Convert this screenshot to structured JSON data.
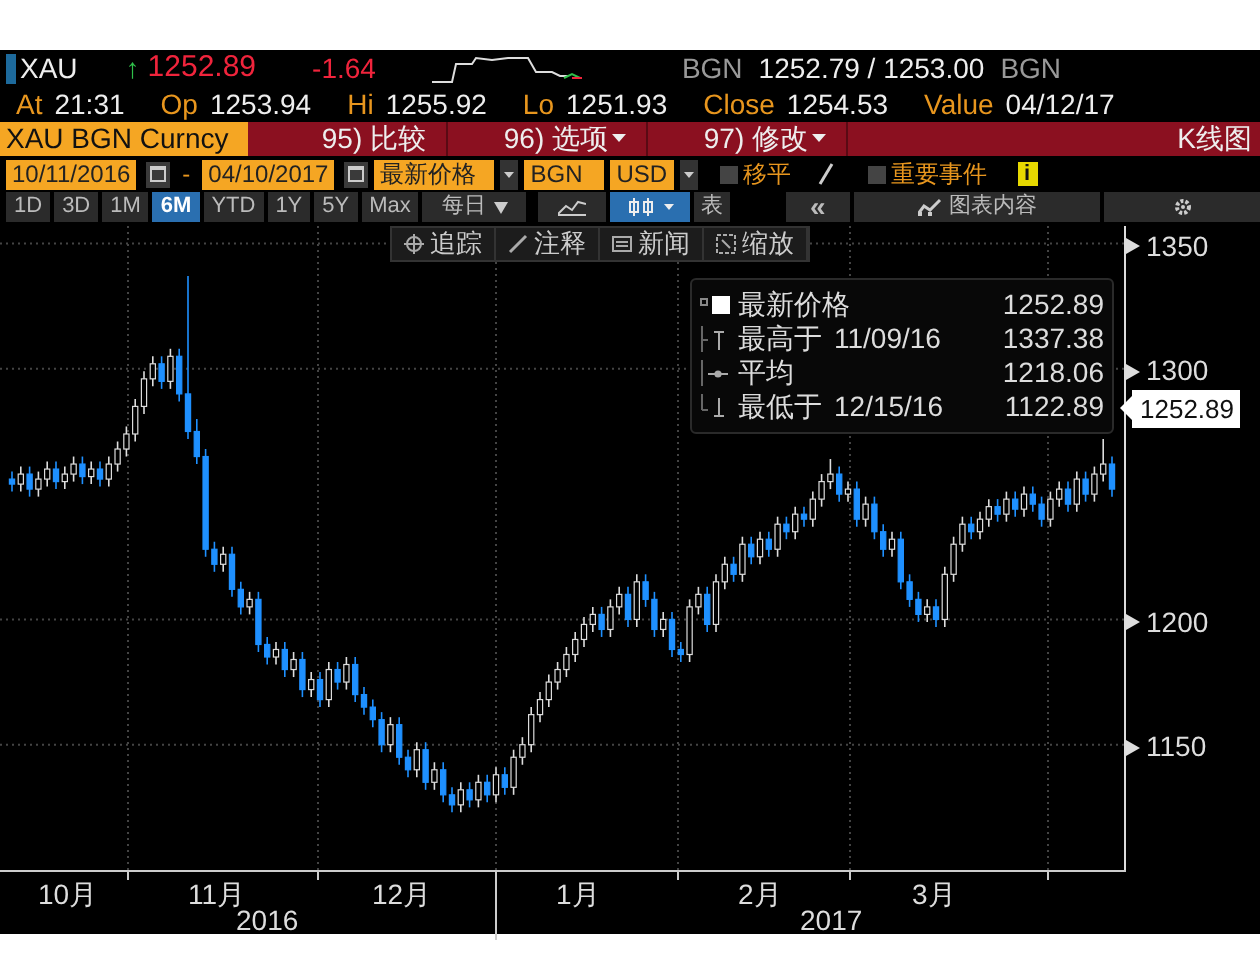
{
  "header": {
    "ticker": "XAU",
    "direction_arrow": "↑",
    "last": "1252.89",
    "change": "-1.64",
    "source": "BGN",
    "bid_ask": "1252.79 / 1253.00",
    "source_2": "BGN"
  },
  "quote_fields": [
    {
      "label": "At",
      "value": "21:31"
    },
    {
      "label": "Op",
      "value": "1253.94"
    },
    {
      "label": "Hi",
      "value": "1255.92"
    },
    {
      "label": "Lo",
      "value": "1251.93"
    },
    {
      "label": "Close",
      "value": "1254.53"
    },
    {
      "label": "Value",
      "value": "04/12/17"
    }
  ],
  "command_bar": {
    "security": "XAU BGN Curncy",
    "menus": [
      {
        "number": "95)",
        "label": "比较",
        "dropdown": false
      },
      {
        "number": "96)",
        "label": "选项",
        "dropdown": true
      },
      {
        "number": "97)",
        "label": "修改",
        "dropdown": true
      }
    ],
    "chart_type": "K线图"
  },
  "settings": {
    "start_date": "10/11/2016",
    "separator": "-",
    "end_date": "04/10/2017",
    "field": "最新价格",
    "source": "BGN",
    "currency": "USD",
    "toggles": [
      {
        "label": "移平",
        "checked": false
      },
      {
        "label": "重要事件",
        "checked": false
      }
    ],
    "info": "i"
  },
  "periods": [
    {
      "label": "1D",
      "selected": false
    },
    {
      "label": "3D",
      "selected": false
    },
    {
      "label": "1M",
      "selected": false
    },
    {
      "label": "6M",
      "selected": true
    },
    {
      "label": "YTD",
      "selected": false
    },
    {
      "label": "1Y",
      "selected": false
    },
    {
      "label": "5Y",
      "selected": false
    },
    {
      "label": "Max",
      "selected": false
    }
  ],
  "frequency": "每日",
  "chart_styles": [
    {
      "kind": "line",
      "selected": false
    },
    {
      "kind": "candle",
      "selected": true
    }
  ],
  "table_button": "表",
  "collapse_button": "«",
  "chart_contents_button": "图表内容",
  "chart_tools": [
    {
      "kind": "crosshair",
      "label": "追踪"
    },
    {
      "kind": "pencil",
      "label": "注释"
    },
    {
      "kind": "news",
      "label": "新闻"
    },
    {
      "kind": "zoom",
      "label": "缩放"
    }
  ],
  "legend": [
    {
      "kind": "last",
      "label": "最新价格",
      "value": "1252.89"
    },
    {
      "kind": "high",
      "label": "最高于",
      "date": "11/09/16",
      "value": "1337.38"
    },
    {
      "kind": "average",
      "label": "平均",
      "value": "1218.06"
    },
    {
      "kind": "low",
      "label": "最低于",
      "date": "12/15/16",
      "value": "1122.89"
    }
  ],
  "chart": {
    "chart_data": {
      "type": "candlestick",
      "grid": true,
      "ylim": [
        1100,
        1357
      ],
      "yticks": [
        {
          "value": 1350,
          "label": "1350"
        },
        {
          "value": 1300,
          "label": "1300"
        },
        {
          "value": 1200,
          "label": "1200"
        },
        {
          "value": 1150,
          "label": "1150"
        }
      ],
      "ohlc": [
        [
          1256,
          1259,
          1251,
          1254
        ],
        [
          1254,
          1261,
          1251,
          1258
        ],
        [
          1258,
          1261,
          1249,
          1252
        ],
        [
          1252,
          1259,
          1249,
          1256
        ],
        [
          1256,
          1263,
          1253,
          1260
        ],
        [
          1260,
          1263,
          1252,
          1255
        ],
        [
          1255,
          1261,
          1252,
          1258
        ],
        [
          1258,
          1265,
          1255,
          1262
        ],
        [
          1262,
          1265,
          1254,
          1257
        ],
        [
          1257,
          1263,
          1254,
          1260
        ],
        [
          1260,
          1263,
          1253,
          1256
        ],
        [
          1256,
          1265,
          1253,
          1262
        ],
        [
          1262,
          1271,
          1259,
          1268
        ],
        [
          1268,
          1277,
          1265,
          1274
        ],
        [
          1274,
          1288,
          1271,
          1285
        ],
        [
          1285,
          1299,
          1282,
          1296
        ],
        [
          1296,
          1305,
          1293,
          1302
        ],
        [
          1302,
          1305,
          1292,
          1295
        ],
        [
          1295,
          1308,
          1292,
          1305
        ],
        [
          1305,
          1308,
          1287,
          1290
        ],
        [
          1290,
          1337,
          1272,
          1275
        ],
        [
          1275,
          1280,
          1262,
          1265
        ],
        [
          1265,
          1268,
          1225,
          1228
        ],
        [
          1228,
          1231,
          1219,
          1222
        ],
        [
          1222,
          1229,
          1219,
          1226
        ],
        [
          1226,
          1229,
          1209,
          1212
        ],
        [
          1212,
          1215,
          1202,
          1205
        ],
        [
          1205,
          1211,
          1202,
          1208
        ],
        [
          1208,
          1211,
          1187,
          1190
        ],
        [
          1190,
          1193,
          1182,
          1185
        ],
        [
          1185,
          1191,
          1182,
          1188
        ],
        [
          1188,
          1191,
          1177,
          1180
        ],
        [
          1180,
          1187,
          1177,
          1184
        ],
        [
          1184,
          1187,
          1169,
          1172
        ],
        [
          1172,
          1179,
          1169,
          1176
        ],
        [
          1176,
          1179,
          1165,
          1168
        ],
        [
          1168,
          1183,
          1165,
          1180
        ],
        [
          1180,
          1183,
          1172,
          1175
        ],
        [
          1175,
          1185,
          1172,
          1182
        ],
        [
          1182,
          1185,
          1167,
          1170
        ],
        [
          1170,
          1173,
          1162,
          1165
        ],
        [
          1165,
          1168,
          1157,
          1160
        ],
        [
          1160,
          1163,
          1147,
          1150
        ],
        [
          1150,
          1161,
          1147,
          1158
        ],
        [
          1158,
          1161,
          1142,
          1145
        ],
        [
          1145,
          1148,
          1137,
          1140
        ],
        [
          1140,
          1151,
          1137,
          1148
        ],
        [
          1148,
          1151,
          1132,
          1135
        ],
        [
          1135,
          1143,
          1132,
          1140
        ],
        [
          1140,
          1143,
          1127,
          1130
        ],
        [
          1130,
          1133,
          1123,
          1126
        ],
        [
          1126,
          1135,
          1123,
          1132
        ],
        [
          1132,
          1135,
          1125,
          1128
        ],
        [
          1128,
          1138,
          1125,
          1135
        ],
        [
          1135,
          1138,
          1127,
          1130
        ],
        [
          1130,
          1141,
          1127,
          1138
        ],
        [
          1138,
          1141,
          1130,
          1133
        ],
        [
          1133,
          1148,
          1130,
          1145
        ],
        [
          1145,
          1153,
          1142,
          1150
        ],
        [
          1150,
          1165,
          1147,
          1162
        ],
        [
          1162,
          1171,
          1159,
          1168
        ],
        [
          1168,
          1178,
          1165,
          1175
        ],
        [
          1175,
          1183,
          1172,
          1180
        ],
        [
          1180,
          1189,
          1177,
          1186
        ],
        [
          1186,
          1195,
          1183,
          1192
        ],
        [
          1192,
          1201,
          1189,
          1198
        ],
        [
          1198,
          1205,
          1195,
          1202
        ],
        [
          1202,
          1205,
          1193,
          1196
        ],
        [
          1196,
          1208,
          1193,
          1205
        ],
        [
          1205,
          1213,
          1202,
          1210
        ],
        [
          1210,
          1213,
          1197,
          1200
        ],
        [
          1200,
          1218,
          1197,
          1215
        ],
        [
          1215,
          1218,
          1205,
          1208
        ],
        [
          1208,
          1211,
          1193,
          1196
        ],
        [
          1196,
          1203,
          1193,
          1200
        ],
        [
          1200,
          1203,
          1185,
          1188
        ],
        [
          1188,
          1191,
          1183,
          1186
        ],
        [
          1186,
          1208,
          1183,
          1205
        ],
        [
          1205,
          1213,
          1202,
          1210
        ],
        [
          1210,
          1213,
          1195,
          1198
        ],
        [
          1198,
          1218,
          1195,
          1215
        ],
        [
          1215,
          1225,
          1212,
          1222
        ],
        [
          1222,
          1225,
          1215,
          1218
        ],
        [
          1218,
          1233,
          1215,
          1230
        ],
        [
          1230,
          1233,
          1222,
          1225
        ],
        [
          1225,
          1235,
          1222,
          1232
        ],
        [
          1232,
          1235,
          1225,
          1228
        ],
        [
          1228,
          1241,
          1225,
          1238
        ],
        [
          1238,
          1241,
          1232,
          1235
        ],
        [
          1235,
          1245,
          1232,
          1242
        ],
        [
          1242,
          1245,
          1237,
          1240
        ],
        [
          1240,
          1251,
          1237,
          1248
        ],
        [
          1248,
          1258,
          1245,
          1255
        ],
        [
          1255,
          1264,
          1252,
          1258
        ],
        [
          1258,
          1261,
          1247,
          1250
        ],
        [
          1250,
          1255,
          1247,
          1252
        ],
        [
          1252,
          1255,
          1237,
          1240
        ],
        [
          1240,
          1249,
          1237,
          1246
        ],
        [
          1246,
          1249,
          1232,
          1235
        ],
        [
          1235,
          1238,
          1225,
          1228
        ],
        [
          1228,
          1235,
          1225,
          1232
        ],
        [
          1232,
          1235,
          1212,
          1215
        ],
        [
          1215,
          1218,
          1205,
          1208
        ],
        [
          1208,
          1211,
          1199,
          1202
        ],
        [
          1202,
          1208,
          1199,
          1205
        ],
        [
          1205,
          1208,
          1197,
          1200
        ],
        [
          1200,
          1221,
          1197,
          1218
        ],
        [
          1218,
          1233,
          1215,
          1230
        ],
        [
          1230,
          1241,
          1227,
          1238
        ],
        [
          1238,
          1241,
          1232,
          1235
        ],
        [
          1235,
          1243,
          1232,
          1240
        ],
        [
          1240,
          1248,
          1237,
          1245
        ],
        [
          1245,
          1248,
          1239,
          1242
        ],
        [
          1242,
          1251,
          1239,
          1248
        ],
        [
          1248,
          1251,
          1241,
          1244
        ],
        [
          1244,
          1253,
          1241,
          1250
        ],
        [
          1250,
          1253,
          1243,
          1246
        ],
        [
          1246,
          1249,
          1237,
          1240
        ],
        [
          1240,
          1251,
          1237,
          1248
        ],
        [
          1248,
          1255,
          1245,
          1252
        ],
        [
          1252,
          1255,
          1243,
          1246
        ],
        [
          1246,
          1259,
          1243,
          1256
        ],
        [
          1256,
          1259,
          1247,
          1250
        ],
        [
          1250,
          1261,
          1247,
          1258
        ],
        [
          1258,
          1272,
          1255,
          1262
        ],
        [
          1262,
          1265,
          1249,
          1252
        ]
      ]
    }
  },
  "price_tag": "1252.89",
  "months": [
    "10月",
    "11月",
    "12月",
    "1月",
    "2月",
    "3月"
  ],
  "years": [
    "2016",
    "2017"
  ]
}
